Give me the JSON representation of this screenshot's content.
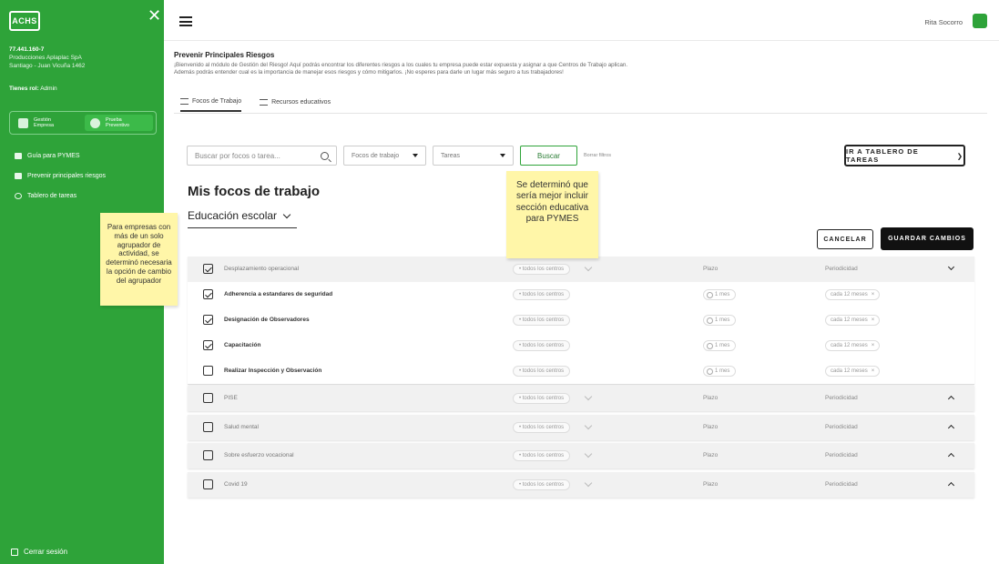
{
  "sidebar": {
    "logo": "ACHS",
    "company_rut": "77.441.160-7",
    "company_name": "Producciones Aplaplac SpA",
    "company_address": "Santiago - Juan Vicuña 1462",
    "role_label": "Tienes rol:",
    "role_value": "Admin",
    "switch": [
      {
        "top": "Gestión",
        "bottom": "Empresa"
      },
      {
        "top": "Prueba",
        "bottom": "Preventivo"
      }
    ],
    "nav": [
      "Guía para PYMES",
      "Prevenir principales riesgos",
      "Tablero de tareas"
    ],
    "logout": "Cerrar sesión"
  },
  "header": {
    "user_name": "Rita Socorro"
  },
  "page": {
    "title": "Prevenir Principales Riesgos",
    "intro": "¡Bienvenido al módulo de Gestión del Riesgo! Aquí podrás encontrar los diferentes riesgos a los cuales tu empresa puede estar expuesta y asignar a que Centros de Trabajo aplican. Además podrás entender cual es la importancia de manejar esos riesgos y cómo mitigarlos. ¡No esperes para darle un lugar más seguro a tus trabajadores!",
    "tabs": [
      "Focos de Trabajo",
      "Recursos educativos"
    ]
  },
  "filters": {
    "search_placeholder": "Buscar por focos o tarea...",
    "select_focos": "Focos de trabajo",
    "select_tareas": "Tareas",
    "buscar": "Buscar",
    "borrar": "Borrar filtros",
    "tablero": "IR A TABLERO DE TAREAS"
  },
  "main": {
    "heading": "Mis focos de trabajo",
    "grupo": "Educación escolar",
    "cancelar": "CANCELAR",
    "guardar": "GUARDAR CAMBIOS"
  },
  "notes": {
    "note1": "Para empresas con más de un solo agrupador de actividad, se determinó necesaria la opción de cambio del agrupador",
    "note2": "Se determinó que sería mejor incluir sección educativa para PYMES"
  },
  "table": {
    "centros": "• todos los centros",
    "plazo": "Plazo",
    "periodicidad": "Periodicidad",
    "mes": "1 mes",
    "cada": "cada 12 meses",
    "expanded": {
      "name": "Desplazamiento operacional",
      "checked": true,
      "items": [
        {
          "name": "Adherencia a estandares de seguridad",
          "checked": true
        },
        {
          "name": "Designación de Observadores",
          "checked": true
        },
        {
          "name": "Capacitación",
          "checked": true
        },
        {
          "name": "Realizar Inspección y Observación",
          "checked": false
        }
      ]
    },
    "collapsed": [
      "PISE",
      "Salud mental",
      "Sobre esfuerzo vocacional",
      "Covid 19"
    ]
  },
  "colors": {
    "brand_green": "#2ea339",
    "note_yellow": "#fff6a8"
  }
}
